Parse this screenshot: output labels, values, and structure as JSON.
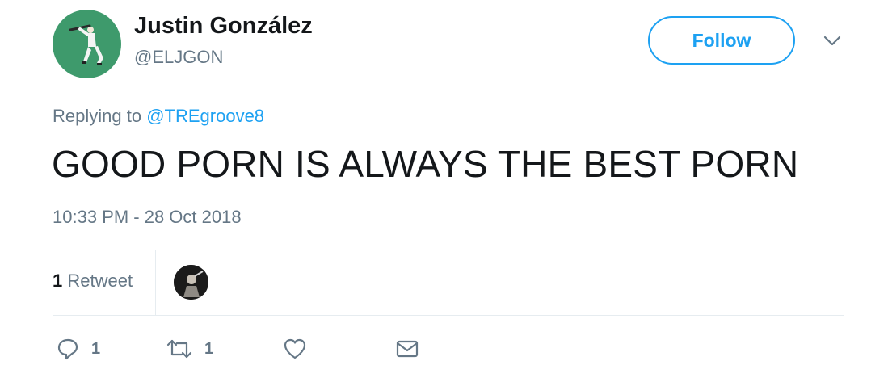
{
  "author": {
    "name": "Justin González",
    "handle": "@ELJGON",
    "avatar_color": "#3e9a6c"
  },
  "follow_label": "Follow",
  "reply": {
    "prefix": "Replying to",
    "target": "@TREgroove8"
  },
  "tweet_text": "GOOD PORN IS ALWAYS THE BEST PORN",
  "timestamp": "10:33 PM - 28 Oct 2018",
  "stats": {
    "retweet_count": "1",
    "retweet_label": "Retweet"
  },
  "actions": {
    "reply_count": "1",
    "retweet_count": "1"
  },
  "colors": {
    "accent": "#1da1f2",
    "secondary_text": "#657786"
  },
  "icons": [
    "chevron-down-icon",
    "reply-icon",
    "retweet-icon",
    "like-icon",
    "message-icon"
  ]
}
